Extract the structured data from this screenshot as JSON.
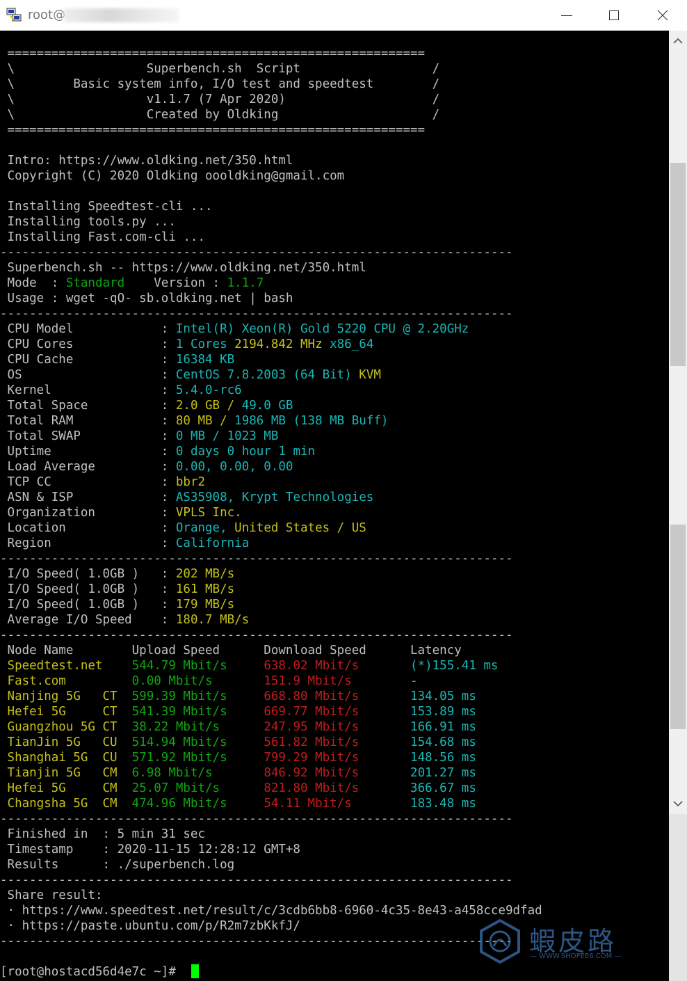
{
  "window": {
    "title": "root@",
    "icons": {
      "app": "putty-icon",
      "minimize": "minimize-icon",
      "maximize": "maximize-icon",
      "close": "close-icon"
    }
  },
  "colors": {
    "default": "#c0c0c0",
    "green": "#11a511",
    "cyan": "#1bb5b5",
    "yellow": "#c5c01a",
    "red": "#c01c1c",
    "cursor": "#00ff00"
  },
  "terminal": {
    "lines": [
      [
        {
          "c": "w",
          "t": " ========================================================="
        }
      ],
      [
        {
          "c": "w",
          "t": " \\                  Superbench.sh  Script                  /"
        }
      ],
      [
        {
          "c": "w",
          "t": " \\        Basic system info, I/O test and speedtest        /"
        }
      ],
      [
        {
          "c": "w",
          "t": " \\                  v1.1.7 (7 Apr 2020)                    /"
        }
      ],
      [
        {
          "c": "w",
          "t": " \\                  Created by Oldking                     /"
        }
      ],
      [
        {
          "c": "w",
          "t": " ========================================================="
        }
      ],
      [],
      [
        {
          "c": "w",
          "t": " Intro: https://www.oldking.net/350.html"
        }
      ],
      [
        {
          "c": "w",
          "t": " Copyright (C) 2020 Oldking oooldking@gmail.com"
        }
      ],
      [],
      [
        {
          "c": "w",
          "t": " Installing Speedtest-cli ..."
        }
      ],
      [
        {
          "c": "w",
          "t": " Installing tools.py ..."
        }
      ],
      [
        {
          "c": "w",
          "t": " Installing Fast.com-cli ..."
        }
      ],
      [
        {
          "c": "w",
          "t": "----------------------------------------------------------------------"
        }
      ],
      [
        {
          "c": "w",
          "t": " Superbench.sh -- https://www.oldking.net/350.html"
        }
      ],
      [
        {
          "c": "w",
          "t": " Mode  : "
        },
        {
          "c": "g",
          "t": "Standard"
        },
        {
          "c": "w",
          "t": "    Version : "
        },
        {
          "c": "g",
          "t": "1.1.7"
        }
      ],
      [
        {
          "c": "w",
          "t": " Usage : wget -qO- sb.oldking.net | bash"
        }
      ],
      [
        {
          "c": "w",
          "t": "----------------------------------------------------------------------"
        }
      ],
      [
        {
          "c": "w",
          "t": " CPU Model            : "
        },
        {
          "c": "c",
          "t": "Intel(R) Xeon(R) Gold 5220 CPU @ 2.20GHz"
        }
      ],
      [
        {
          "c": "w",
          "t": " CPU Cores            : "
        },
        {
          "c": "c",
          "t": "1 Cores "
        },
        {
          "c": "y",
          "t": "2194.842 MHz "
        },
        {
          "c": "c",
          "t": "x86_64"
        }
      ],
      [
        {
          "c": "w",
          "t": " CPU Cache            : "
        },
        {
          "c": "c",
          "t": "16384 KB"
        }
      ],
      [
        {
          "c": "w",
          "t": " OS                   : "
        },
        {
          "c": "c",
          "t": "CentOS 7.8.2003 (64 Bit) "
        },
        {
          "c": "y",
          "t": "KVM"
        }
      ],
      [
        {
          "c": "w",
          "t": " Kernel               : "
        },
        {
          "c": "c",
          "t": "5.4.0-rc6"
        }
      ],
      [
        {
          "c": "w",
          "t": " Total Space          : "
        },
        {
          "c": "y",
          "t": "2.0 GB / "
        },
        {
          "c": "c",
          "t": "49.0 GB"
        }
      ],
      [
        {
          "c": "w",
          "t": " Total RAM            : "
        },
        {
          "c": "y",
          "t": "80 MB / "
        },
        {
          "c": "c",
          "t": "1986 MB "
        },
        {
          "c": "c",
          "t": "(138 MB Buff)"
        }
      ],
      [
        {
          "c": "w",
          "t": " Total SWAP           : "
        },
        {
          "c": "c",
          "t": "0 MB / 1023 MB"
        }
      ],
      [
        {
          "c": "w",
          "t": " Uptime               : "
        },
        {
          "c": "c",
          "t": "0 days 0 hour 1 min"
        }
      ],
      [
        {
          "c": "w",
          "t": " Load Average         : "
        },
        {
          "c": "c",
          "t": "0.00, 0.00, 0.00"
        }
      ],
      [
        {
          "c": "w",
          "t": " TCP CC               : "
        },
        {
          "c": "y",
          "t": "bbr2"
        }
      ],
      [
        {
          "c": "w",
          "t": " ASN & ISP            : "
        },
        {
          "c": "c",
          "t": "AS35908, Krypt Technologies"
        }
      ],
      [
        {
          "c": "w",
          "t": " Organization         : "
        },
        {
          "c": "y",
          "t": "VPLS Inc."
        }
      ],
      [
        {
          "c": "w",
          "t": " Location             : "
        },
        {
          "c": "c",
          "t": "Orange, "
        },
        {
          "c": "y",
          "t": "United States / US"
        }
      ],
      [
        {
          "c": "w",
          "t": " Region               : "
        },
        {
          "c": "c",
          "t": "California"
        }
      ],
      [
        {
          "c": "w",
          "t": "----------------------------------------------------------------------"
        }
      ],
      [
        {
          "c": "w",
          "t": " I/O Speed( 1.0GB )   : "
        },
        {
          "c": "y",
          "t": "202 MB/s"
        }
      ],
      [
        {
          "c": "w",
          "t": " I/O Speed( 1.0GB )   : "
        },
        {
          "c": "y",
          "t": "161 MB/s"
        }
      ],
      [
        {
          "c": "w",
          "t": " I/O Speed( 1.0GB )   : "
        },
        {
          "c": "y",
          "t": "179 MB/s"
        }
      ],
      [
        {
          "c": "w",
          "t": " Average I/O Speed    : "
        },
        {
          "c": "y",
          "t": "180.7 MB/s"
        }
      ],
      [
        {
          "c": "w",
          "t": "----------------------------------------------------------------------"
        }
      ],
      [
        {
          "c": "w",
          "t": " Node Name        Upload Speed      Download Speed      Latency"
        }
      ],
      [
        {
          "c": "y",
          "t": " Speedtest.net    "
        },
        {
          "c": "g",
          "t": "544.79 Mbit/s     "
        },
        {
          "c": "r",
          "t": "638.02 Mbit/s       "
        },
        {
          "c": "c",
          "t": "(*)155.41 ms"
        }
      ],
      [
        {
          "c": "y",
          "t": " Fast.com         "
        },
        {
          "c": "g",
          "t": "0.00 Mbit/s       "
        },
        {
          "c": "r",
          "t": "151.9 Mbit/s        "
        },
        {
          "c": "c",
          "t": "-"
        }
      ],
      [
        {
          "c": "y",
          "t": " Nanjing 5G   CT  "
        },
        {
          "c": "g",
          "t": "599.39 Mbit/s     "
        },
        {
          "c": "r",
          "t": "668.80 Mbit/s       "
        },
        {
          "c": "c",
          "t": "134.05 ms"
        }
      ],
      [
        {
          "c": "y",
          "t": " Hefei 5G     CT  "
        },
        {
          "c": "g",
          "t": "541.39 Mbit/s     "
        },
        {
          "c": "r",
          "t": "669.77 Mbit/s       "
        },
        {
          "c": "c",
          "t": "153.89 ms"
        }
      ],
      [
        {
          "c": "y",
          "t": " Guangzhou 5G CT  "
        },
        {
          "c": "g",
          "t": "38.22 Mbit/s      "
        },
        {
          "c": "r",
          "t": "247.95 Mbit/s       "
        },
        {
          "c": "c",
          "t": "166.91 ms"
        }
      ],
      [
        {
          "c": "y",
          "t": " TianJin 5G   CU  "
        },
        {
          "c": "g",
          "t": "514.94 Mbit/s     "
        },
        {
          "c": "r",
          "t": "561.82 Mbit/s       "
        },
        {
          "c": "c",
          "t": "154.68 ms"
        }
      ],
      [
        {
          "c": "y",
          "t": " Shanghai 5G  CU  "
        },
        {
          "c": "g",
          "t": "571.92 Mbit/s     "
        },
        {
          "c": "r",
          "t": "799.29 Mbit/s       "
        },
        {
          "c": "c",
          "t": "148.56 ms"
        }
      ],
      [
        {
          "c": "y",
          "t": " Tianjin 5G   CM  "
        },
        {
          "c": "g",
          "t": "6.98 Mbit/s       "
        },
        {
          "c": "r",
          "t": "846.92 Mbit/s       "
        },
        {
          "c": "c",
          "t": "201.27 ms"
        }
      ],
      [
        {
          "c": "y",
          "t": " Hefei 5G     CM  "
        },
        {
          "c": "g",
          "t": "25.07 Mbit/s      "
        },
        {
          "c": "r",
          "t": "821.80 Mbit/s       "
        },
        {
          "c": "c",
          "t": "366.67 ms"
        }
      ],
      [
        {
          "c": "y",
          "t": " Changsha 5G  CM  "
        },
        {
          "c": "g",
          "t": "474.96 Mbit/s     "
        },
        {
          "c": "r",
          "t": "54.11 Mbit/s        "
        },
        {
          "c": "c",
          "t": "183.48 ms"
        }
      ],
      [
        {
          "c": "w",
          "t": "----------------------------------------------------------------------"
        }
      ],
      [
        {
          "c": "w",
          "t": " Finished in  : 5 min 31 sec"
        }
      ],
      [
        {
          "c": "w",
          "t": " Timestamp    : 2020-11-15 12:28:12 GMT+8"
        }
      ],
      [
        {
          "c": "w",
          "t": " Results      : ./superbench.log"
        }
      ],
      [
        {
          "c": "w",
          "t": "----------------------------------------------------------------------"
        }
      ],
      [
        {
          "c": "w",
          "t": " Share result:"
        }
      ],
      [
        {
          "c": "w",
          "t": " · https://www.speedtest.net/result/c/3cdb6bb8-6960-4c35-8e43-a458cce9dfad"
        }
      ],
      [
        {
          "c": "w",
          "t": " · https://paste.ubuntu.com/p/R2m7zbKkfJ/"
        }
      ],
      [
        {
          "c": "w",
          "t": "----------------------------------------------------------------------"
        }
      ],
      [],
      [
        {
          "c": "w",
          "t": "[root@hostacd56d4e7c ~]# "
        }
      ]
    ]
  },
  "watermark": {
    "text": "蝦皮路",
    "sub": "— WWW.SHOPEE6.COM —"
  }
}
